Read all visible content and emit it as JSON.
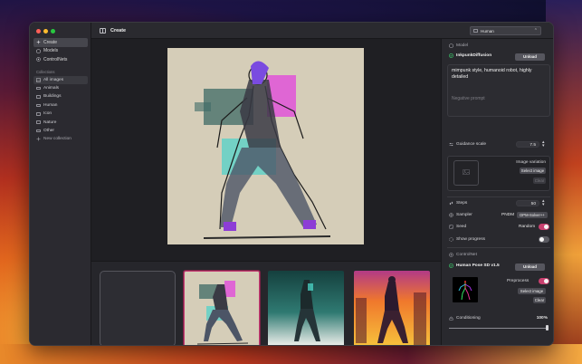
{
  "window": {
    "title": "Create"
  },
  "sidebar": {
    "nav": [
      {
        "label": "Create",
        "icon": "sparkle-icon",
        "active": true
      },
      {
        "label": "Models",
        "icon": "cube-icon",
        "active": false
      },
      {
        "label": "ControlNets",
        "icon": "controlnet-icon",
        "active": false
      }
    ],
    "collections_header": "Collections",
    "collections": [
      {
        "label": "All images",
        "active": true
      },
      {
        "label": "Animals",
        "active": false
      },
      {
        "label": "Buildings",
        "active": false
      },
      {
        "label": "Human",
        "active": false
      },
      {
        "label": "Icon",
        "active": false
      },
      {
        "label": "Nature",
        "active": false
      },
      {
        "label": "Other",
        "active": false
      }
    ],
    "new_collection": "New collection"
  },
  "toolbar": {
    "collection_value": "Human"
  },
  "inspector": {
    "model": {
      "header": "Model",
      "name": "InkpunkDiffusion",
      "unload": "Unload"
    },
    "prompt": "mimpunk style, humanoid robot, highly detailed",
    "negative_prompt_placeholder": "Negative prompt",
    "guidance": {
      "label": "Guidance scale",
      "value": "7.5"
    },
    "image_variation": {
      "label": "Image variation",
      "select": "Select image",
      "clear": "Clear"
    },
    "steps": {
      "label": "Steps",
      "value": "50"
    },
    "sampler": {
      "label": "Sampler",
      "option1": "PNDM",
      "option2": "DPM-Solver++"
    },
    "seed": {
      "label": "Seed",
      "value": "Random"
    },
    "show_progress": {
      "label": "Show progress"
    },
    "controlnet": {
      "header": "ControlNet",
      "name": "Human Pose SD v1.5",
      "unload": "Unload",
      "preprocess": "Preprocess",
      "select": "Select image",
      "clear": "Clear",
      "conditioning_label": "Conditioning",
      "conditioning_value": "100%",
      "conditioning_fraction": 1.0
    }
  },
  "colors": {
    "accent": "#c43a72",
    "toggle_on": "#c9406f",
    "toggle_off": "#5b5b62",
    "model_ok": "#3cc46a",
    "traffic_red": "#fe5f57",
    "traffic_yellow": "#febc2e",
    "traffic_green": "#28c840"
  }
}
